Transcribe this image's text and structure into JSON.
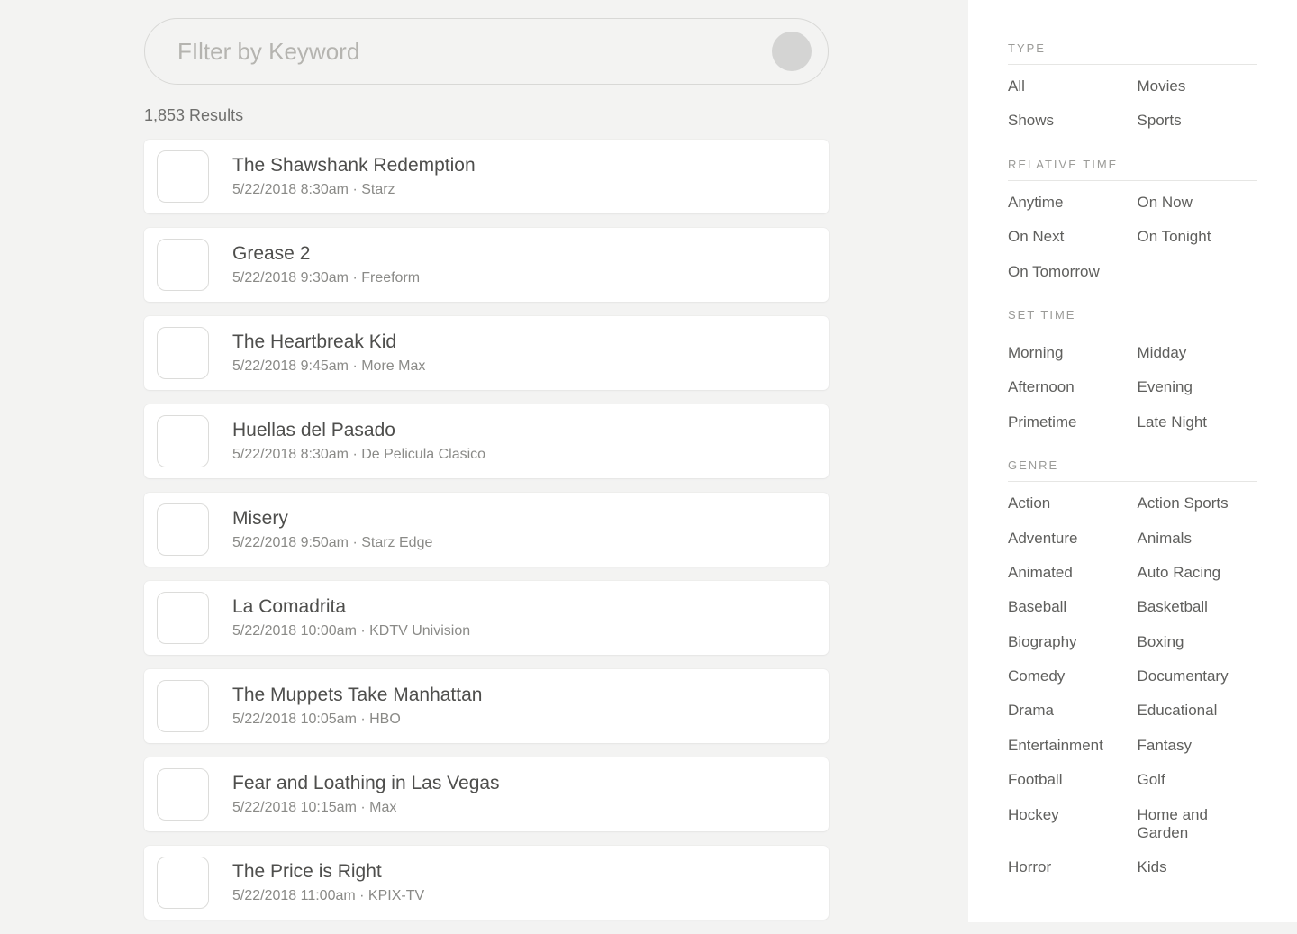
{
  "search": {
    "placeholder": "FIlter by Keyword"
  },
  "results_count": "1,853 Results",
  "results": [
    {
      "title": "The Shawshank Redemption",
      "meta": "5/22/2018 8:30am · Starz"
    },
    {
      "title": "Grease 2",
      "meta": "5/22/2018 9:30am · Freeform"
    },
    {
      "title": "The Heartbreak Kid",
      "meta": "5/22/2018 9:45am · More Max"
    },
    {
      "title": "Huellas del Pasado",
      "meta": "5/22/2018 8:30am · De Pelicula Clasico"
    },
    {
      "title": "Misery",
      "meta": "5/22/2018 9:50am · Starz Edge"
    },
    {
      "title": "La Comadrita",
      "meta": "5/22/2018 10:00am · KDTV Univision"
    },
    {
      "title": "The Muppets Take Manhattan",
      "meta": "5/22/2018 10:05am · HBO"
    },
    {
      "title": "Fear and Loathing in Las Vegas",
      "meta": "5/22/2018 10:15am · Max"
    },
    {
      "title": "The Price is Right",
      "meta": "5/22/2018 11:00am · KPIX-TV"
    }
  ],
  "filters": {
    "type": {
      "heading": "TYPE",
      "items": [
        "All",
        "Movies",
        "Shows",
        "Sports"
      ]
    },
    "relative_time": {
      "heading": "RELATIVE TIME",
      "items": [
        "Anytime",
        "On Now",
        "On Next",
        "On Tonight",
        "On Tomorrow"
      ]
    },
    "set_time": {
      "heading": "SET TIME",
      "items": [
        "Morning",
        "Midday",
        "Afternoon",
        "Evening",
        "Primetime",
        "Late Night"
      ]
    },
    "genre": {
      "heading": "GENRE",
      "items": [
        "Action",
        "Action Sports",
        "Adventure",
        "Animals",
        "Animated",
        "Auto Racing",
        "Baseball",
        "Basketball",
        "Biography",
        "Boxing",
        "Comedy",
        "Documentary",
        "Drama",
        "Educational",
        "Entertainment",
        "Fantasy",
        "Football",
        "Golf",
        "Hockey",
        "Home and Garden",
        "Horror",
        "Kids"
      ]
    }
  }
}
